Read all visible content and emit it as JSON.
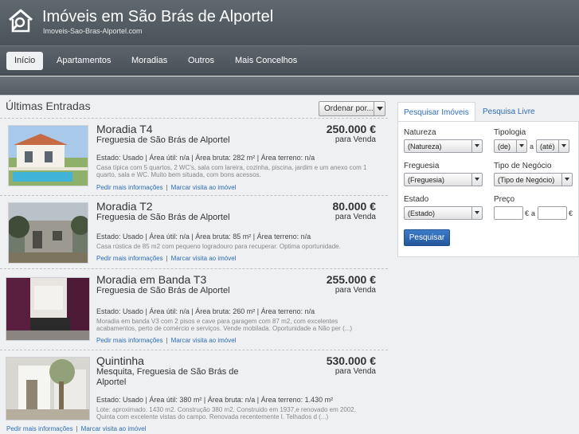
{
  "header": {
    "title": "Imóveis em São Brás de Alportel",
    "subtitle": "Imoveis-Sao-Bras-Alportel.com",
    "logo_icon": "house-search-icon"
  },
  "nav": {
    "items": [
      {
        "label": "Início",
        "active": true
      },
      {
        "label": "Apartamentos"
      },
      {
        "label": "Moradias"
      },
      {
        "label": "Outros"
      },
      {
        "label": "Mais Concelhos"
      }
    ]
  },
  "listings_title": "Últimas Entradas",
  "sort_label": "Ordenar por...",
  "listings": [
    {
      "title": "Moradia  T4",
      "parish": "Freguesia de São Brás de Alportel",
      "price": "250.000 €",
      "deal": "para Venda",
      "facts": "Estado: Usado  | Área útil: n/a  | Área bruta: 282 m²  | Área terreno: n/a",
      "desc": "Casa típica com 5 quartos, 2 WC's, sala com lareira, cozinha, piscina, jardim e um anexo com 1 quarto, sala e WC. Muito bem situada, com bons acessos.",
      "link_info": "Pedir mais informações",
      "link_visit": "Marcar visita ao imóvel"
    },
    {
      "title": "Moradia  T2",
      "parish": "Freguesia de São Brás de Alportel",
      "price": "80.000 €",
      "deal": "para Venda",
      "facts": "Estado: Usado  | Área útil: n/a  | Área bruta: 85 m²  | Área terreno: n/a",
      "desc": "Casa rústica de 85 m2 com pequeno logradouro para recuperar. Optima oportunidade.",
      "link_info": "Pedir mais informações",
      "link_visit": "Marcar visita ao imóvel"
    },
    {
      "title": "Moradia em Banda  T3",
      "parish": "Freguesia de São Brás de Alportel",
      "price": "255.000 €",
      "deal": "para Venda",
      "facts": "Estado: Usado  | Área útil: n/a  | Área bruta: 260 m²  | Área terreno: n/a",
      "desc": "Moradia em banda V3 com 2 pisos e cave para garagem com 87 m2, com excelentes acabamentos, perto de comércio e serviços. Vende mobilada. Oportunidade a Não per (...)",
      "link_info": "Pedir mais informações",
      "link_visit": "Marcar visita ao imóvel"
    },
    {
      "title": "Quintinha",
      "parish": "Mesquita, Freguesia de São Brás de Alportel",
      "price": "530.000 €",
      "deal": "para Venda",
      "facts": "Estado: Usado  | Área útil: 380 m²  | Área bruta: n/a  | Área terreno: 1.430 m²",
      "desc": "Lote: aproximado. 1430 m2. Construção 380 m2. Construido em 1937,e renovado em 2002. Quinta com excelente vistas do campo. Renovada recentemente I. Telhados d (...)",
      "link_info": "Pedir mais informações",
      "link_visit": "Marcar visita ao imóvel"
    }
  ],
  "search": {
    "tab_main": "Pesquisar Imóveis",
    "tab_free": "Pesquisa Livre",
    "natureza_label": "Natureza",
    "natureza_value": "(Natureza)",
    "tipologia_label": "Tipologia",
    "tipologia_from": "(de)",
    "tipologia_sep": "a",
    "tipologia_to": "(até)",
    "freguesia_label": "Freguesia",
    "freguesia_value": "(Freguesia)",
    "negocio_label": "Tipo de Negócio",
    "negocio_value": "(Tipo de Negócio)",
    "estado_label": "Estado",
    "estado_value": "(Estado)",
    "preco_label": "Preço",
    "preco_currency": "€",
    "preco_sep": "a",
    "button": "Pesquisar"
  }
}
